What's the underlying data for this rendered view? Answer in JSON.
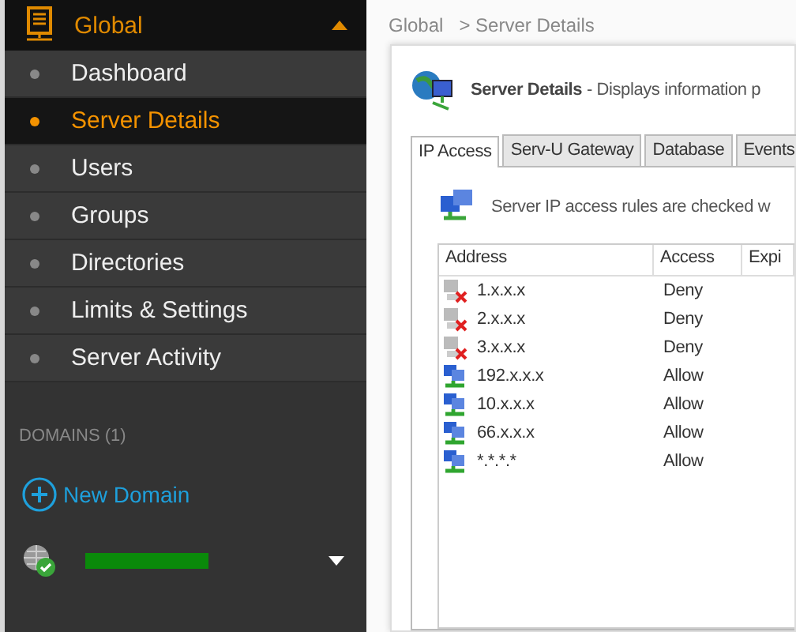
{
  "sidebar": {
    "header": {
      "label": "Global",
      "expanded": true
    },
    "items": [
      {
        "label": "Dashboard",
        "selected": false
      },
      {
        "label": "Server Details",
        "selected": true
      },
      {
        "label": "Users",
        "selected": false
      },
      {
        "label": "Groups",
        "selected": false
      },
      {
        "label": "Directories",
        "selected": false
      },
      {
        "label": "Limits & Settings",
        "selected": false
      },
      {
        "label": "Server Activity",
        "selected": false
      }
    ],
    "domains_heading": "DOMAINS (1)",
    "new_domain": "New Domain",
    "domain": {
      "expanded": false
    }
  },
  "breadcrumb": [
    "Global",
    "> Server Details"
  ],
  "panel": {
    "title": "Server Details",
    "description": "- Displays information p",
    "tabs": [
      {
        "label": "IP Access",
        "selected": true
      },
      {
        "label": "Serv-U Gateway",
        "selected": false
      },
      {
        "label": "Database",
        "selected": false
      },
      {
        "label": "Events",
        "selected": false
      }
    ],
    "info": "Server IP access rules are checked w",
    "table": {
      "columns": [
        "Address",
        "Access",
        "Expi"
      ],
      "rows": [
        {
          "kind": "deny",
          "address": "1.x.x.x",
          "access": "Deny"
        },
        {
          "kind": "deny",
          "address": "2.x.x.x",
          "access": "Deny"
        },
        {
          "kind": "deny",
          "address": "3.x.x.x",
          "access": "Deny"
        },
        {
          "kind": "allow",
          "address": "192.x.x.x",
          "access": "Allow"
        },
        {
          "kind": "allow",
          "address": "10.x.x.x",
          "access": "Allow"
        },
        {
          "kind": "allow",
          "address": "66.x.x.x",
          "access": "Allow"
        },
        {
          "kind": "allow",
          "address": "*.*.*.*",
          "access": "Allow"
        }
      ]
    }
  }
}
